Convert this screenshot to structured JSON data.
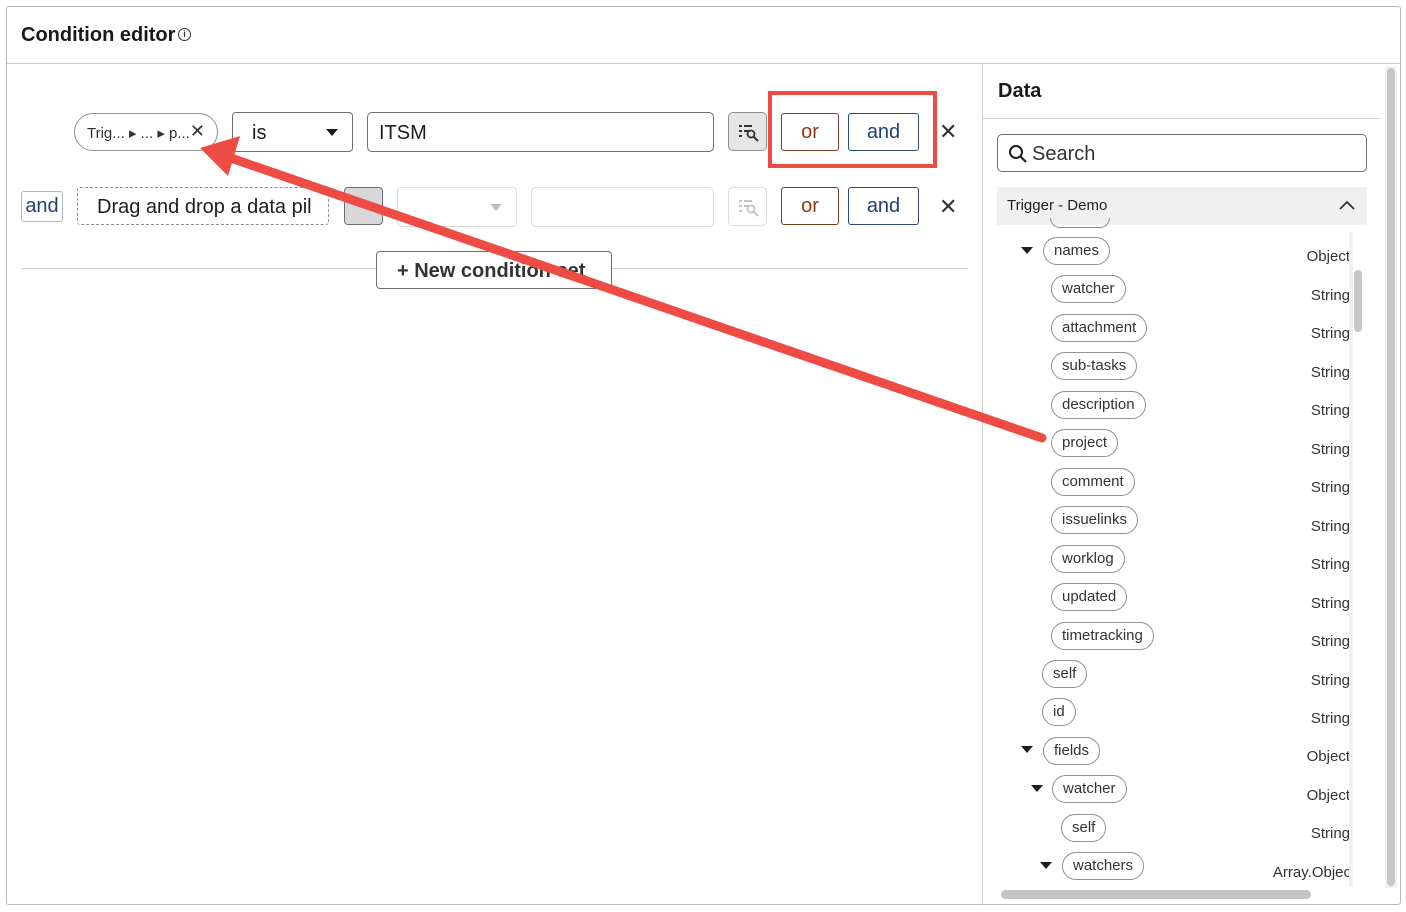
{
  "header": {
    "title": "Condition editor",
    "info_glyph": "i"
  },
  "row1": {
    "pill": "Trig... ▸ ... ▸ p...",
    "pill_close": "✕",
    "operator": "is",
    "value": "ITSM",
    "or": "or",
    "and": "and",
    "delete": "✕"
  },
  "row2": {
    "connector": "and",
    "drop_placeholder": "Drag and drop a data pil",
    "or": "or",
    "and": "and",
    "delete": "✕"
  },
  "new_condition_set": "+ New condition set",
  "data_panel": {
    "title": "Data",
    "search_placeholder": "Search",
    "trigger": "Trigger - Demo",
    "tree": [
      {
        "label": "names",
        "type": "Object"
      },
      {
        "label": "watcher",
        "type": "String"
      },
      {
        "label": "attachment",
        "type": "String"
      },
      {
        "label": "sub-tasks",
        "type": "String"
      },
      {
        "label": "description",
        "type": "String"
      },
      {
        "label": "project",
        "type": "String"
      },
      {
        "label": "comment",
        "type": "String"
      },
      {
        "label": "issuelinks",
        "type": "String"
      },
      {
        "label": "worklog",
        "type": "String"
      },
      {
        "label": "updated",
        "type": "String"
      },
      {
        "label": "timetracking",
        "type": "String"
      },
      {
        "label": "self",
        "type": "String"
      },
      {
        "label": "id",
        "type": "String"
      },
      {
        "label": "fields",
        "type": "Object"
      },
      {
        "label": "watcher",
        "type": "Object"
      },
      {
        "label": "self",
        "type": "String"
      },
      {
        "label": "watchers",
        "type": "Array.Objec"
      }
    ]
  },
  "colors": {
    "annotation_red": "#ee4b45",
    "or_color": "#8a3a12",
    "and_color": "#1f3f77"
  }
}
